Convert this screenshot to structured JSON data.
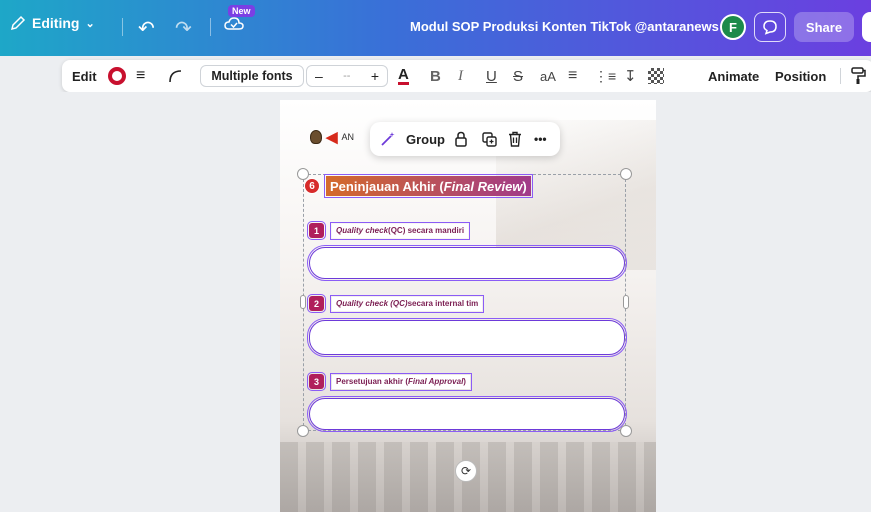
{
  "topbar": {
    "editing_label": "Editing",
    "new_badge": "New",
    "doc_title": "Modul SOP Produksi Konten TikTok @antaranews",
    "avatar_initial": "F",
    "share_label": "Share"
  },
  "toolbar": {
    "edit_label": "Edit",
    "font_label": "Multiple fonts",
    "minus": "–",
    "size_placeholder": "--",
    "plus": "+",
    "text_color_letter": "A",
    "bold_letter": "B",
    "italic_letter": "I",
    "underline_letter": "U",
    "strike_letter": "S",
    "case_label": "aA",
    "animate_label": "Animate",
    "position_label": "Position"
  },
  "floatbar": {
    "group_label": "Group",
    "more_label": "•••"
  },
  "page": {
    "logo_text": "AN",
    "heading_number": "6",
    "heading_text": "Peninjauan Akhir (",
    "heading_italic": "Final Review",
    "heading_close": ")",
    "items": [
      {
        "number": "1",
        "label_italic": "Quality check",
        "label_rest": " (QC) secara mandiri"
      },
      {
        "number": "2",
        "label_italic": "Quality check (QC)",
        "label_rest": " secara internal tim"
      },
      {
        "number": "3",
        "label_plain": "Persetujuan akhir (",
        "label_italic": "Final Approval",
        "label_close": ")"
      }
    ]
  },
  "colors": {
    "accent": "#8b5cf6",
    "heading_red": "#d72b2b",
    "item_magenta": "#b01f5b"
  }
}
